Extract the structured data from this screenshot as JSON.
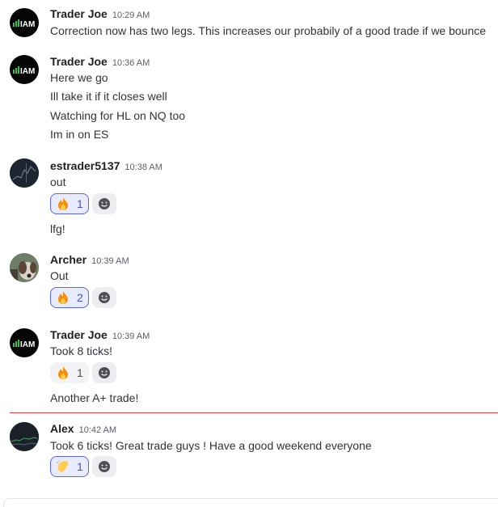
{
  "messages": [
    {
      "author": "Trader Joe",
      "time": "10:29 AM",
      "avatar": "iam-logo",
      "lines": [
        "Correction now has two legs. This increases our probabily of a good trade if we bounce"
      ]
    },
    {
      "author": "Trader Joe",
      "time": "10:36 AM",
      "avatar": "iam-logo",
      "lines": [
        "Here we go",
        "Ill take it if it closes well",
        "Watching for HL on NQ too",
        "Im in on ES"
      ]
    },
    {
      "author": "estrader5137",
      "time": "10:38 AM",
      "avatar": "chart-avatar",
      "lines": [
        "out",
        "lfg!"
      ],
      "reactions": [
        {
          "emoji": "fire-emoji",
          "count": "1",
          "active": true
        }
      ]
    },
    {
      "author": "Archer",
      "time": "10:39 AM",
      "avatar": "dog-photo-avatar",
      "lines": [
        "Out"
      ],
      "reactions": [
        {
          "emoji": "fire-emoji",
          "count": "2",
          "active": true
        }
      ]
    },
    {
      "author": "Trader Joe",
      "time": "10:39 AM",
      "avatar": "iam-logo",
      "lines": [
        "Took 8 ticks!",
        "Another A+ trade!"
      ],
      "reactions": [
        {
          "emoji": "fire-emoji",
          "count": "1",
          "active": false
        }
      ]
    },
    {
      "author": "Alex",
      "time": "10:42 AM",
      "avatar": "chart-avatar",
      "lines": [
        "Took 6 ticks! Great trade guys ! Have a good weekend everyone"
      ],
      "reactions": [
        {
          "emoji": "clap-emoji",
          "count": "1",
          "active": true
        }
      ]
    }
  ],
  "logo_text": "IAM",
  "colors": {
    "new_message_divider": "#e8434a",
    "reaction_active_border": "#5865f2",
    "reaction_active_bg": "#e8eafd"
  }
}
